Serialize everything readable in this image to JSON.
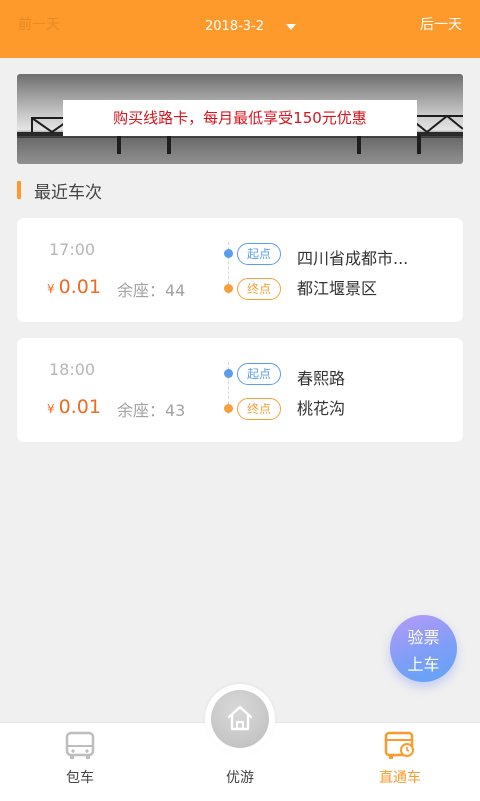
{
  "header": {
    "prev_label": "前一天",
    "date": "2018-3-2",
    "next_label": "后一天",
    "accent_color": "#fe9a2c"
  },
  "banner": {
    "promo_text": "购买线路卡，每月最低享受150元优惠"
  },
  "section": {
    "title": "最近车次"
  },
  "trips": [
    {
      "time": "17:00",
      "currency": "¥",
      "price": "0.01",
      "seats_label": "余座：44",
      "start_tag": "起点",
      "start_stop": "四川省成都市...",
      "end_tag": "终点",
      "end_stop": "都江堰景区"
    },
    {
      "time": "18:00",
      "currency": "¥",
      "price": "0.01",
      "seats_label": "余座：43",
      "start_tag": "起点",
      "start_stop": "春熙路",
      "end_tag": "终点",
      "end_stop": "桃花沟"
    }
  ],
  "fab": {
    "line1": "验票",
    "line2": "上车"
  },
  "tabbar": {
    "tabs": [
      {
        "label": "包车",
        "icon": "bus-icon"
      },
      {
        "label": "优游",
        "icon": "home-icon"
      },
      {
        "label": "直通车",
        "icon": "express-bus-icon",
        "active": true
      }
    ]
  }
}
